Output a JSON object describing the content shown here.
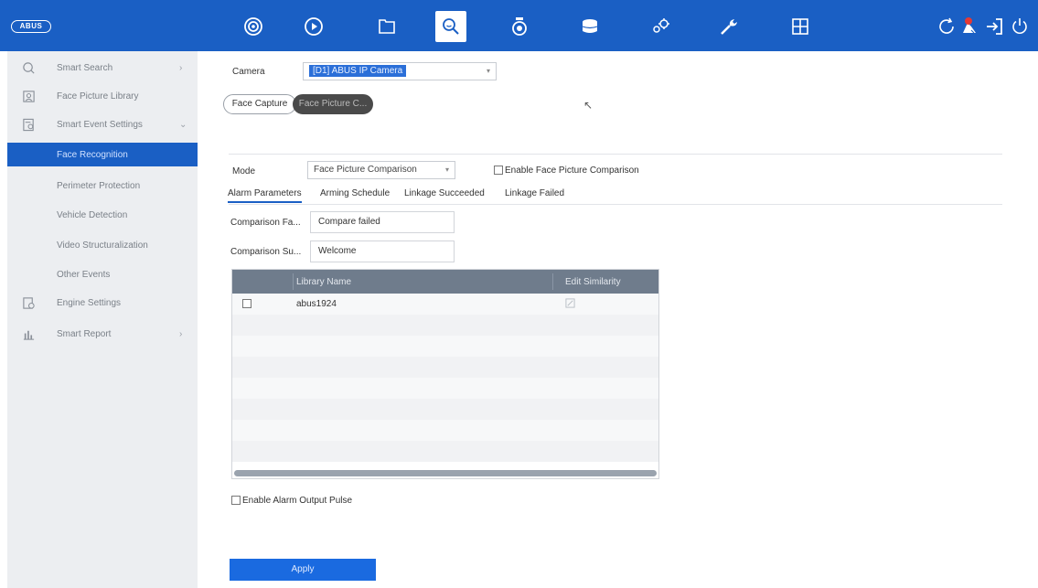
{
  "app": {
    "logo_text": "ABUS"
  },
  "topbar": {
    "icons": [
      "live-view-icon",
      "playback-icon",
      "file-icon",
      "smart-search-icon",
      "camera-icon",
      "storage-icon",
      "settings-icon",
      "maintenance-icon",
      "layout-icon",
      "refresh-icon",
      "alarm-icon",
      "logout-icon",
      "power-icon"
    ],
    "active": "smart-search-icon",
    "accent": "#1a5fc4",
    "alarm_badge_color": "#e53935"
  },
  "sidebar": {
    "items": [
      {
        "label": "Smart Search",
        "icon": "search-icon",
        "chevron": "›"
      },
      {
        "label": "Face Picture Library",
        "icon": "face-library-icon"
      },
      {
        "label": "Smart Event Settings",
        "icon": "event-settings-icon",
        "chevron": "⌄"
      },
      {
        "label": "Face Recognition",
        "sub": true,
        "active": true
      },
      {
        "label": "Perimeter Protection",
        "sub": true
      },
      {
        "label": "Vehicle Detection",
        "sub": true
      },
      {
        "label": "Video Structuralization",
        "sub": true
      },
      {
        "label": "Other Events",
        "sub": true
      },
      {
        "label": "Engine Settings",
        "icon": "engine-icon"
      },
      {
        "label": "Smart Report",
        "icon": "report-icon",
        "chevron": "›"
      }
    ]
  },
  "main": {
    "camera_label": "Camera",
    "camera_value": "[D1] ABUS IP Camera",
    "pills": [
      "Face Capture",
      "Face Picture C..."
    ],
    "mode_label": "Mode",
    "mode_value": "Face Picture Comparison",
    "enable_comparison": "Enable Face Picture Comparison",
    "tabs": [
      "Alarm Parameters",
      "Arming Schedule",
      "Linkage Succeeded",
      "Linkage Failed"
    ],
    "fields": [
      {
        "label": "Comparison Fa...",
        "value": "Compare failed"
      },
      {
        "label": "Comparison Su...",
        "value": "Welcome"
      }
    ],
    "table": {
      "columns": [
        "Library Name",
        "Edit Similarity"
      ],
      "rows": [
        {
          "name": "abus1924"
        }
      ]
    },
    "enable_alarm_output": "Enable Alarm Output Pulse",
    "apply_label": "Apply"
  }
}
